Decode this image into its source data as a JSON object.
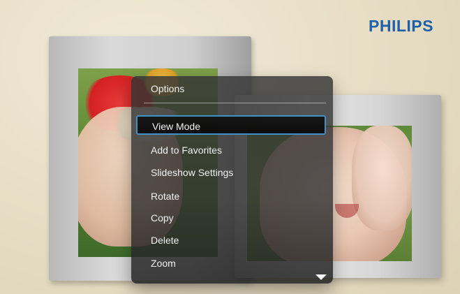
{
  "brand": {
    "logo_text": "PHILIPS",
    "logo_color": "#1f5fa8"
  },
  "options_menu": {
    "title": "Options",
    "selected_index": 0,
    "items": [
      {
        "label": "View Mode"
      },
      {
        "label": "Add to Favorites"
      },
      {
        "label": "Slideshow Settings"
      },
      {
        "label": "Rotate"
      },
      {
        "label": "Copy"
      },
      {
        "label": "Delete"
      },
      {
        "label": "Zoom"
      }
    ],
    "scroll_indicator": "chevron-down-icon",
    "selected_border_color": "#3f92c7"
  }
}
